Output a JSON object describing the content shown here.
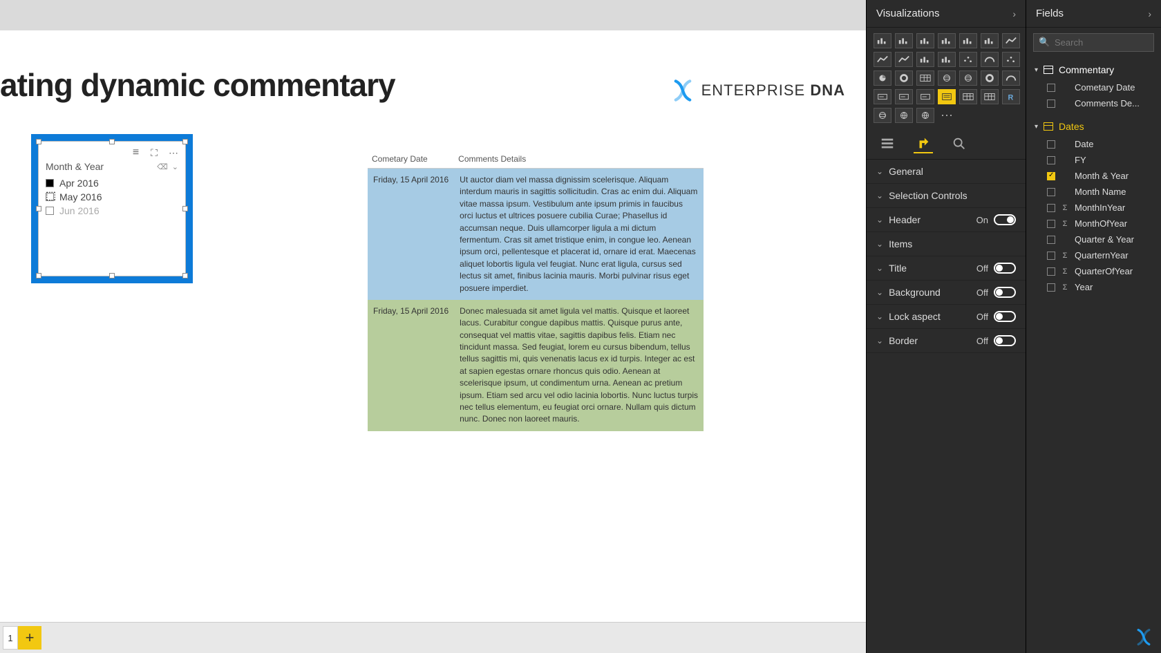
{
  "report": {
    "title": "ating dynamic commentary",
    "logo_text_a": "ENTERPRISE",
    "logo_text_b": "DNA",
    "tab_current": "1"
  },
  "slicer": {
    "field": "Month & Year",
    "items": [
      {
        "label": "Apr 2016",
        "checked": true,
        "dim": false
      },
      {
        "label": "May 2016",
        "checked": false,
        "dim": false
      },
      {
        "label": "Jun 2016",
        "checked": false,
        "dim": true
      }
    ]
  },
  "table": {
    "headers": {
      "c0": "Cometary Date",
      "c1": "Comments Details"
    },
    "rows": [
      {
        "date": "Friday, 15 April 2016",
        "text": "Ut auctor diam vel massa dignissim scelerisque. Aliquam interdum mauris in sagittis sollicitudin. Cras ac enim dui. Aliquam vitae massa ipsum. Vestibulum ante ipsum primis in faucibus orci luctus et ultrices posuere cubilia Curae; Phasellus id accumsan neque. Duis ullamcorper ligula a mi dictum fermentum. Cras sit amet tristique enim, in congue leo. Aenean ipsum orci, pellentesque et placerat id, ornare id erat. Maecenas aliquet lobortis ligula vel feugiat. Nunc erat ligula, cursus sed lectus sit amet, finibus lacinia mauris. Morbi pulvinar risus eget posuere imperdiet.",
        "cls": "row-blue"
      },
      {
        "date": "Friday, 15 April 2016",
        "text": "Donec malesuada sit amet ligula vel mattis. Quisque et laoreet lacus. Curabitur congue dapibus mattis. Quisque purus ante, consequat vel mattis vitae, sagittis dapibus felis. Etiam nec tincidunt massa. Sed feugiat, lorem eu cursus bibendum, tellus tellus sagittis mi, quis venenatis lacus ex id turpis. Integer ac est at sapien egestas ornare rhoncus quis odio. Aenean at scelerisque ipsum, ut condimentum urna. Aenean ac pretium ipsum. Etiam sed arcu vel odio lacinia lobortis. Nunc luctus turpis nec tellus elementum, eu feugiat orci ornare. Nullam quis dictum nunc. Donec non laoreet mauris.",
        "cls": "row-green"
      }
    ]
  },
  "vizPanel": {
    "title": "Visualizations",
    "tabs": {
      "fields": "fields-tab-icon",
      "format": "format-tab-icon",
      "analytics": "analytics-tab-icon"
    },
    "format": [
      {
        "label": "General",
        "hasToggle": false
      },
      {
        "label": "Selection Controls",
        "hasToggle": false
      },
      {
        "label": "Header",
        "hasToggle": true,
        "state": "On",
        "on": true
      },
      {
        "label": "Items",
        "hasToggle": false
      },
      {
        "label": "Title",
        "hasToggle": true,
        "state": "Off",
        "on": false
      },
      {
        "label": "Background",
        "hasToggle": true,
        "state": "Off",
        "on": false
      },
      {
        "label": "Lock aspect",
        "hasToggle": true,
        "state": "Off",
        "on": false
      },
      {
        "label": "Border",
        "hasToggle": true,
        "state": "Off",
        "on": false
      }
    ],
    "gallery": [
      "stacked-bar",
      "clustered-bar",
      "stacked-column",
      "clustered-column",
      "100-bar",
      "100-column",
      "line",
      "area",
      "stacked-area",
      "line-bar",
      "line-column",
      "ribbon",
      "waterfall",
      "scatter",
      "pie",
      "donut",
      "treemap",
      "map",
      "filled-map",
      "funnel",
      "gauge",
      "card",
      "multi-card",
      "kpi",
      "slicer",
      "table",
      "matrix",
      "r-visual",
      "arcgis",
      "python",
      "globe",
      "ellipsis"
    ],
    "selected_gallery_index": 24
  },
  "fieldsPanel": {
    "title": "Fields",
    "search_placeholder": "Search",
    "tables": [
      {
        "name": "Commentary",
        "active": false,
        "fields": [
          {
            "name": "Cometary Date",
            "checked": false,
            "icon": ""
          },
          {
            "name": "Comments De...",
            "checked": false,
            "icon": ""
          }
        ]
      },
      {
        "name": "Dates",
        "active": true,
        "fields": [
          {
            "name": "Date",
            "checked": false,
            "icon": ""
          },
          {
            "name": "FY",
            "checked": false,
            "icon": ""
          },
          {
            "name": "Month & Year",
            "checked": true,
            "icon": ""
          },
          {
            "name": "Month Name",
            "checked": false,
            "icon": ""
          },
          {
            "name": "MonthInYear",
            "checked": false,
            "icon": "Σ"
          },
          {
            "name": "MonthOfYear",
            "checked": false,
            "icon": "Σ"
          },
          {
            "name": "Quarter & Year",
            "checked": false,
            "icon": ""
          },
          {
            "name": "QuarternYear",
            "checked": false,
            "icon": "Σ"
          },
          {
            "name": "QuarterOfYear",
            "checked": false,
            "icon": "Σ"
          },
          {
            "name": "Year",
            "checked": false,
            "icon": "Σ"
          }
        ]
      }
    ]
  }
}
